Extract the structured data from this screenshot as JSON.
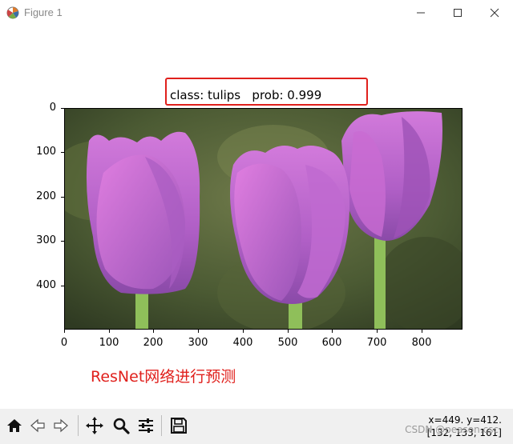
{
  "window": {
    "title": "Figure 1",
    "controls": [
      "minimize-icon",
      "maximize-icon",
      "close-icon"
    ]
  },
  "figure": {
    "title": "class: tulips   prob: 0.999",
    "y_ticks": [
      "0",
      "100",
      "200",
      "300",
      "400"
    ],
    "x_ticks": [
      "0",
      "100",
      "200",
      "300",
      "400",
      "500",
      "600",
      "700",
      "800"
    ],
    "annotation": "ResNet网络进行预测",
    "highlight_color": "#e0201c"
  },
  "toolbar": {
    "buttons": [
      "home-icon",
      "back-icon",
      "forward-icon",
      "pan-icon",
      "zoom-icon",
      "configure-subplots-icon",
      "save-icon"
    ],
    "coords_line1": "x=449. y=412.",
    "coords_line2": "[132, 133, 161]",
    "watermark": "CSDN @peason.csc"
  }
}
